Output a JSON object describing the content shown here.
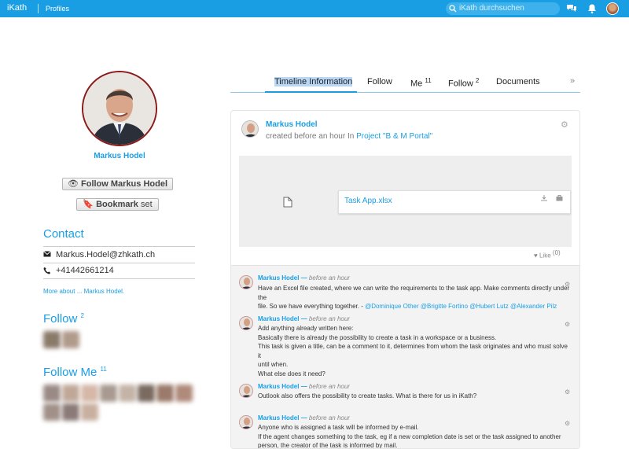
{
  "topbar": {
    "brand": "iKath",
    "breadcrumb": "Profiles",
    "search_placeholder": "iKath durchsuchen",
    "icons": [
      "search-icon",
      "chat-icon",
      "bell-icon",
      "user-avatar"
    ]
  },
  "profile": {
    "name": "Markus Hodel",
    "follow_button": "Follow Markus Hodel",
    "bookmark_bold": "Bookmark",
    "bookmark_rest": " set"
  },
  "contact": {
    "title": "Contact",
    "email": "Markus.Hodel@zhkath.ch",
    "phone": "+41442661214",
    "more_link": "More about ... Markus Hodel."
  },
  "follow": {
    "title": "Follow",
    "count": "2"
  },
  "follow_me": {
    "title": "Follow Me",
    "count": "11"
  },
  "tabs": [
    {
      "label": "Timeline Information",
      "count": ""
    },
    {
      "label": "Follow",
      "count": ""
    },
    {
      "label": "Me",
      "count": "11"
    },
    {
      "label": "Follow",
      "count": "2"
    },
    {
      "label": "Documents",
      "count": ""
    }
  ],
  "post": {
    "author": "Markus Hodel",
    "meta_prefix": "created before an hour In ",
    "project": "Project \"B & M Portal\"",
    "file_name": "Task App.xlsx",
    "like_label": "Like",
    "like_count": "(0)"
  },
  "comments": [
    {
      "author": "Markus Hodel",
      "when": "before an hour",
      "lines": [
        "Have an Excel file created, where we can write the requirements to the task app. Make comments directly under the",
        "file. So we have everything together. - "
      ],
      "mentions": "@Dominique Other @Brigitte Fortino @Hubert Lutz @Alexander Pilz"
    },
    {
      "author": "Markus Hodel",
      "when": "before an hour",
      "lines": [
        "Add anything already written here:",
        "Basically there is already the possibility to create a task in a workspace or a business.",
        "This task is given a title, can be a comment to it, determines from whom the task originates and who must solve it",
        "until when.",
        "What else does it need?"
      ]
    },
    {
      "author": "Markus Hodel",
      "when": "before an hour",
      "lines": [
        "Outlook also offers the possibility to create tasks. What is there for us in iKath?"
      ]
    },
    {
      "author": "Markus Hodel",
      "when": "before an hour",
      "lines": [
        "Anyone who is assigned a task will be informed by e-mail.",
        "If the agent changes something to the task, eg if a new completion date is set or the task assigned to another",
        "person, the creator of the task is informed by mail."
      ]
    }
  ],
  "colors": {
    "accent": "#1a9ee3",
    "photo_border": "#8b1a1a"
  }
}
